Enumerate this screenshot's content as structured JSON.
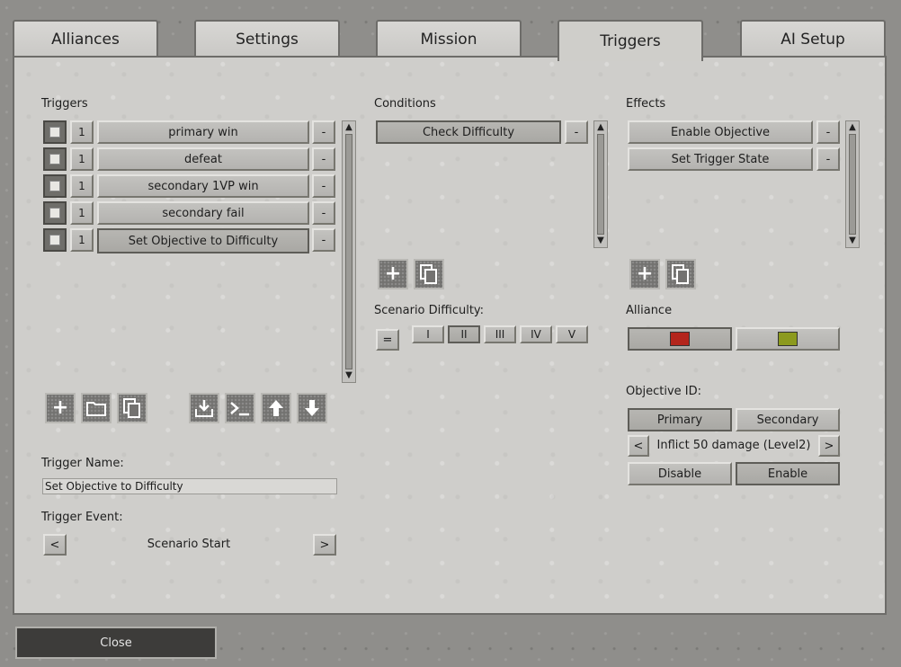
{
  "tabs": [
    {
      "label": "Alliances"
    },
    {
      "label": "Settings"
    },
    {
      "label": "Mission"
    },
    {
      "label": "Triggers"
    },
    {
      "label": "AI Setup"
    }
  ],
  "triggers": {
    "heading": "Triggers",
    "items": [
      {
        "count": "1",
        "name": "primary win"
      },
      {
        "count": "1",
        "name": "defeat"
      },
      {
        "count": "1",
        "name": "secondary 1VP win"
      },
      {
        "count": "1",
        "name": "secondary fail"
      },
      {
        "count": "1",
        "name": "Set Objective to Difficulty"
      }
    ],
    "remove_label": "-",
    "name_label": "Trigger Name:",
    "name_value": "Set Objective to Difficulty",
    "event_label": "Trigger Event:",
    "event_value": "Scenario Start",
    "prev": "<",
    "next": ">"
  },
  "conditions": {
    "heading": "Conditions",
    "items": [
      {
        "name": "Check Difficulty"
      }
    ],
    "remove_label": "-",
    "difficulty_label": "Scenario Difficulty:",
    "operator": "=",
    "levels": [
      "I",
      "II",
      "III",
      "IV",
      "V"
    ]
  },
  "effects": {
    "heading": "Effects",
    "items": [
      {
        "name": "Enable Objective"
      },
      {
        "name": "Set Trigger State"
      }
    ],
    "remove_label": "-",
    "alliance_label": "Alliance",
    "alliance_colors": [
      "#b3251c",
      "#8c9a1e"
    ],
    "objective_label": "Objective ID:",
    "primary": "Primary",
    "secondary": "Secondary",
    "objective_value": "Inflict 50 damage (Level2)",
    "prev": "<",
    "next": ">",
    "disable": "Disable",
    "enable": "Enable"
  },
  "footer": {
    "close": "Close"
  }
}
